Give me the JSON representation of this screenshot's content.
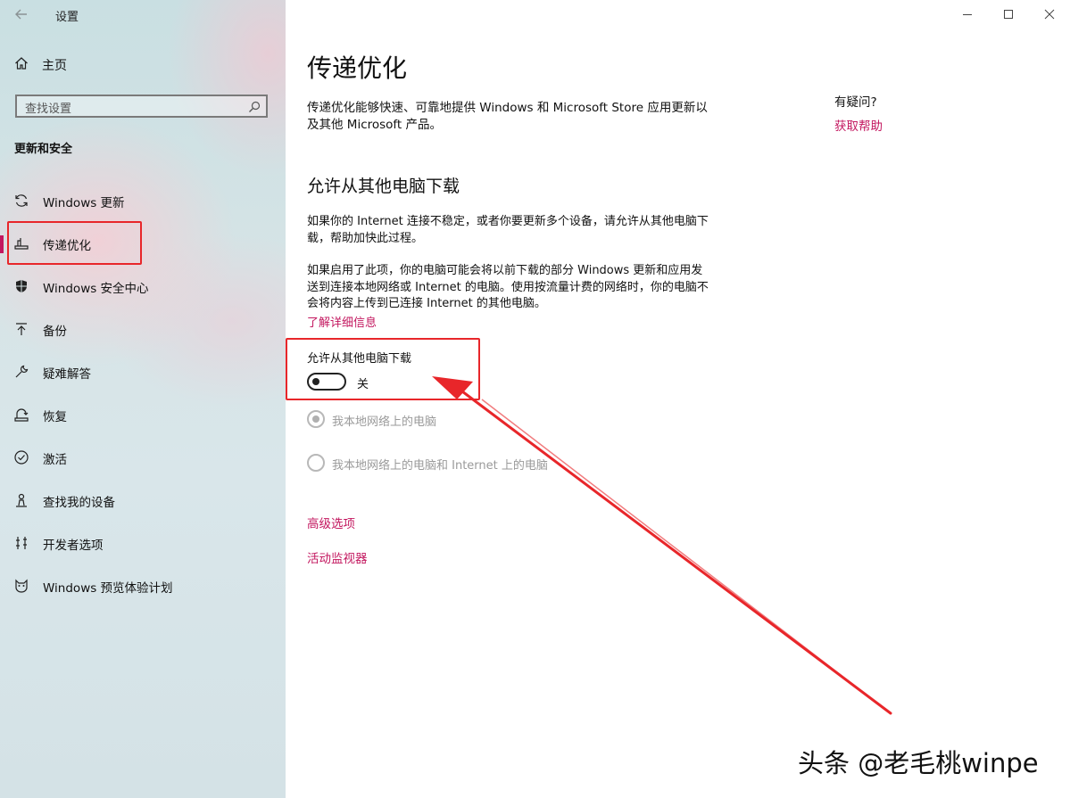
{
  "window": {
    "app_title": "设置",
    "controls": {
      "minimize": "—",
      "maximize": "☐",
      "close": "✕"
    }
  },
  "sidebar": {
    "home_label": "主页",
    "search_placeholder": "查找设置",
    "section_title": "更新和安全",
    "items": [
      {
        "label": "Windows 更新",
        "icon": "refresh-icon"
      },
      {
        "label": "传递优化",
        "icon": "delivery-icon",
        "active": true
      },
      {
        "label": "Windows 安全中心",
        "icon": "shield-icon"
      },
      {
        "label": "备份",
        "icon": "backup-icon"
      },
      {
        "label": "疑难解答",
        "icon": "wrench-icon"
      },
      {
        "label": "恢复",
        "icon": "recovery-icon"
      },
      {
        "label": "激活",
        "icon": "check-circle-icon"
      },
      {
        "label": "查找我的设备",
        "icon": "person-pin-icon"
      },
      {
        "label": "开发者选项",
        "icon": "developer-icon"
      },
      {
        "label": "Windows 预览体验计划",
        "icon": "cat-icon"
      }
    ]
  },
  "main": {
    "title": "传递优化",
    "description": "传递优化能够快速、可靠地提供 Windows 和 Microsoft Store 应用更新以及其他 Microsoft 产品。",
    "help": {
      "question": "有疑问?",
      "link": "获取帮助"
    },
    "subheading": "允许从其他电脑下载",
    "paragraph1": "如果你的 Internet 连接不稳定，或者你要更新多个设备，请允许从其他电脑下载，帮助加快此过程。",
    "paragraph2": "如果启用了此项，你的电脑可能会将以前下载的部分 Windows 更新和应用发送到连接本地网络或 Internet 的电脑。使用按流量计费的网络时，你的电脑不会将内容上传到已连接 Internet 的其他电脑。",
    "learn_more": "了解详细信息",
    "toggle": {
      "label": "允许从其他电脑下载",
      "state_text": "关",
      "on": false
    },
    "radios": [
      {
        "label": "我本地网络上的电脑",
        "selected": true,
        "disabled": true
      },
      {
        "label": "我本地网络上的电脑和 Internet 上的电脑",
        "selected": false,
        "disabled": true
      }
    ],
    "links": {
      "advanced": "高级选项",
      "monitor": "活动监视器"
    }
  },
  "colors": {
    "accent": "#c3175f",
    "annotation_red": "#e8262a"
  },
  "watermark": "头条 @老毛桃winpe"
}
